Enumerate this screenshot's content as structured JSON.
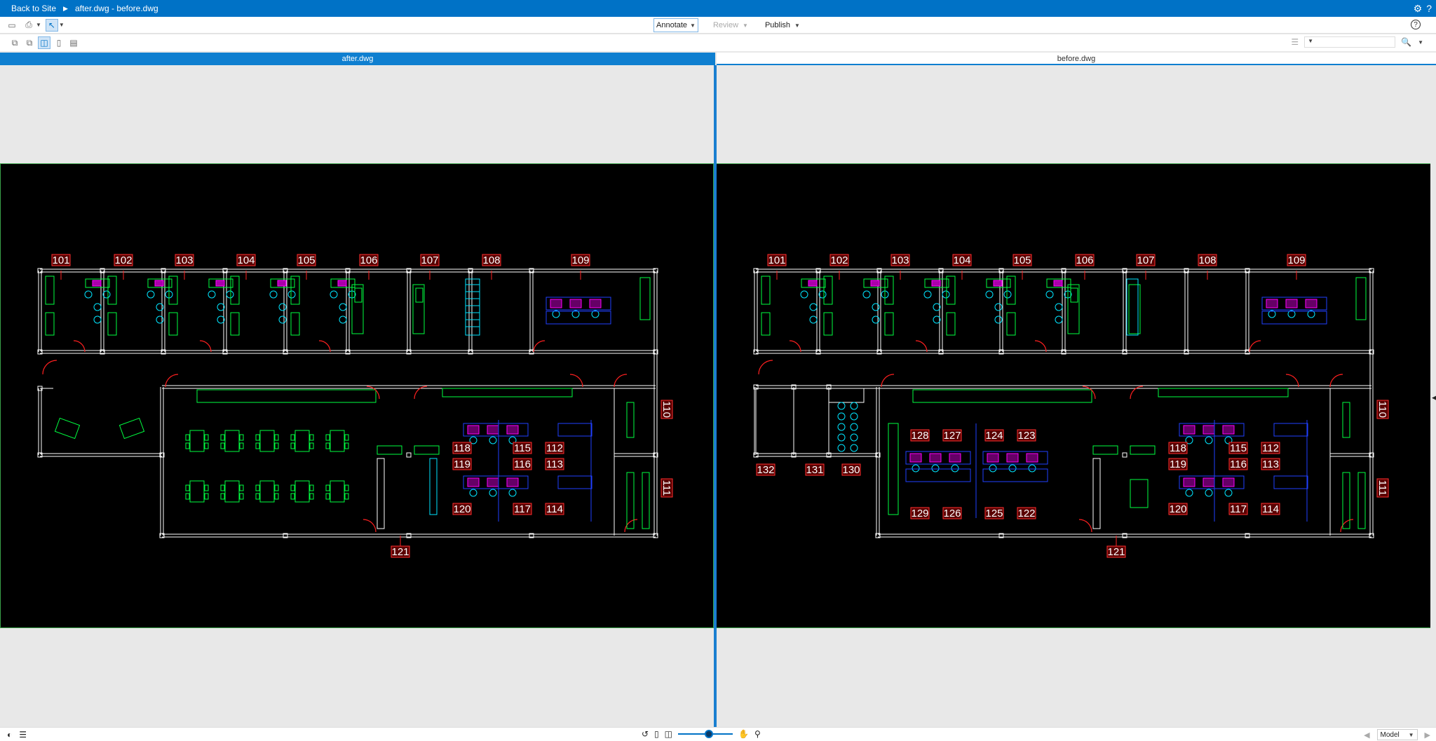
{
  "titlebar": {
    "back_label": "Back to Site",
    "doc_title": "after.dwg - before.dwg"
  },
  "toolbar": {
    "annotate": "Annotate",
    "review": "Review",
    "publish": "Publish"
  },
  "tabs": {
    "left": "after.dwg",
    "right": "before.dwg"
  },
  "status": {
    "model": "Model"
  },
  "icons": [
    "gear-icon",
    "help-icon",
    "print-icon",
    "select-icon",
    "search-icon",
    "undo-icon",
    "pan-icon"
  ],
  "after_labels": {
    "top_rooms": [
      "101",
      "102",
      "103",
      "104",
      "105",
      "106",
      "107",
      "108",
      "109"
    ],
    "side_rooms": [
      "110",
      "111"
    ],
    "desk_rooms": [
      "118",
      "115",
      "112",
      "119",
      "116",
      "113",
      "120",
      "117",
      "114"
    ],
    "bottom_room": "121"
  },
  "before_labels": {
    "top_rooms": [
      "101",
      "102",
      "103",
      "104",
      "105",
      "106",
      "107",
      "108",
      "109"
    ],
    "side_rooms": [
      "110",
      "111"
    ],
    "left_rooms": [
      "132",
      "131",
      "130"
    ],
    "mid_rooms": [
      "128",
      "127",
      "124",
      "123",
      "129",
      "126",
      "125",
      "122"
    ],
    "desk_rooms": [
      "118",
      "115",
      "112",
      "119",
      "116",
      "113",
      "120",
      "117",
      "114"
    ],
    "bottom_room": "121"
  }
}
